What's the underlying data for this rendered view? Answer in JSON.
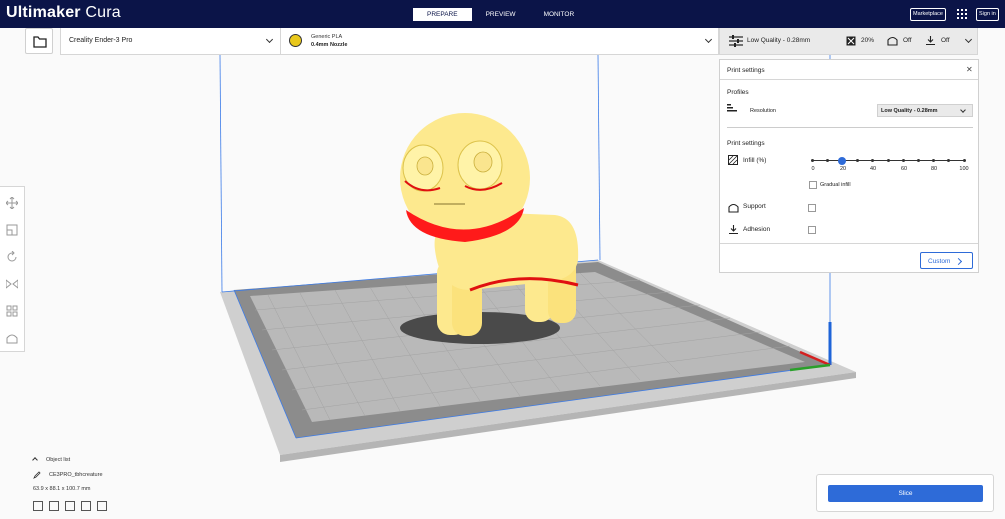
{
  "app": {
    "logo_bold": "Ultimaker",
    "logo_light": "Cura"
  },
  "stages": [
    "PREPARE",
    "PREVIEW",
    "MONITOR"
  ],
  "active_stage": "PREPARE",
  "header_right": {
    "marketplace": "Marketplace",
    "apps_icon": "apps-grid-icon",
    "sign_in": "Sign in"
  },
  "printer": {
    "name": "Creality Ender-3 Pro",
    "icon": "chevron-down-icon"
  },
  "material": {
    "name": "Generic PLA",
    "nozzle": "0.4mm Nozzle",
    "color": "#e9c81b"
  },
  "quality_bar": {
    "profile": "Low Quality - 0.28mm",
    "infill": "20%",
    "support": "Off",
    "adhesion": "Off"
  },
  "print_settings": {
    "title": "Print settings",
    "profiles_label": "Profiles",
    "resolution_label": "Resolution",
    "resolution_value": "Low Quality - 0.28mm",
    "section_label": "Print settings",
    "infill_label": "Infill (%)",
    "infill_value": 20,
    "infill_ticks": [
      "0",
      "20",
      "40",
      "60",
      "80",
      "100"
    ],
    "gradual_infill_label": "Gradual infill",
    "support_label": "Support",
    "adhesion_label": "Adhesion",
    "custom_button": "Custom",
    "accent": "#2e6bd8"
  },
  "object_list": {
    "header": "Object list",
    "object_name": "CE3PRO_tbhcreature",
    "dimensions": "63.9 x 88.1 x 100.7 mm"
  },
  "slice": {
    "label": "Slice"
  }
}
